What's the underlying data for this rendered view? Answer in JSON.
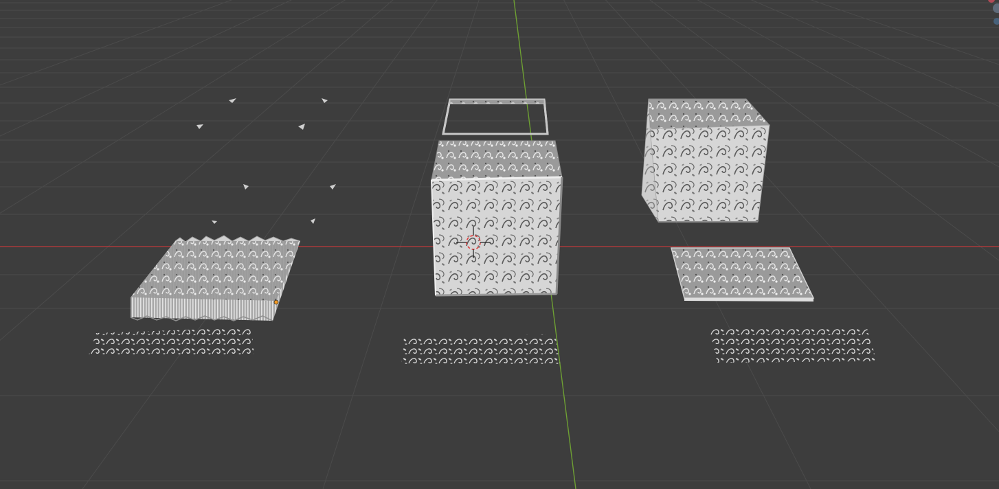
{
  "app": {
    "name": "3D Viewport",
    "view": "perspective"
  },
  "viewport": {
    "background": "#3d3d3d",
    "grid_color": "#4b4b4b",
    "x_axis_color": "#c0393b",
    "y_axis_color": "#6ea033",
    "object_color": "#c9c9c9"
  },
  "objects": [
    {
      "name": "displaced-plane-selected",
      "type": "mesh"
    },
    {
      "name": "ornament-cube-with-lid",
      "type": "mesh"
    },
    {
      "name": "ornament-cube",
      "type": "mesh"
    },
    {
      "name": "ornament-tile",
      "type": "mesh"
    },
    {
      "name": "ornament-strip-1",
      "type": "mesh"
    },
    {
      "name": "ornament-strip-2",
      "type": "mesh"
    },
    {
      "name": "ornament-strip-3",
      "type": "mesh"
    }
  ],
  "icons": [
    "3d-cursor-icon",
    "origin-dot-icon",
    "gizmo-icon"
  ]
}
